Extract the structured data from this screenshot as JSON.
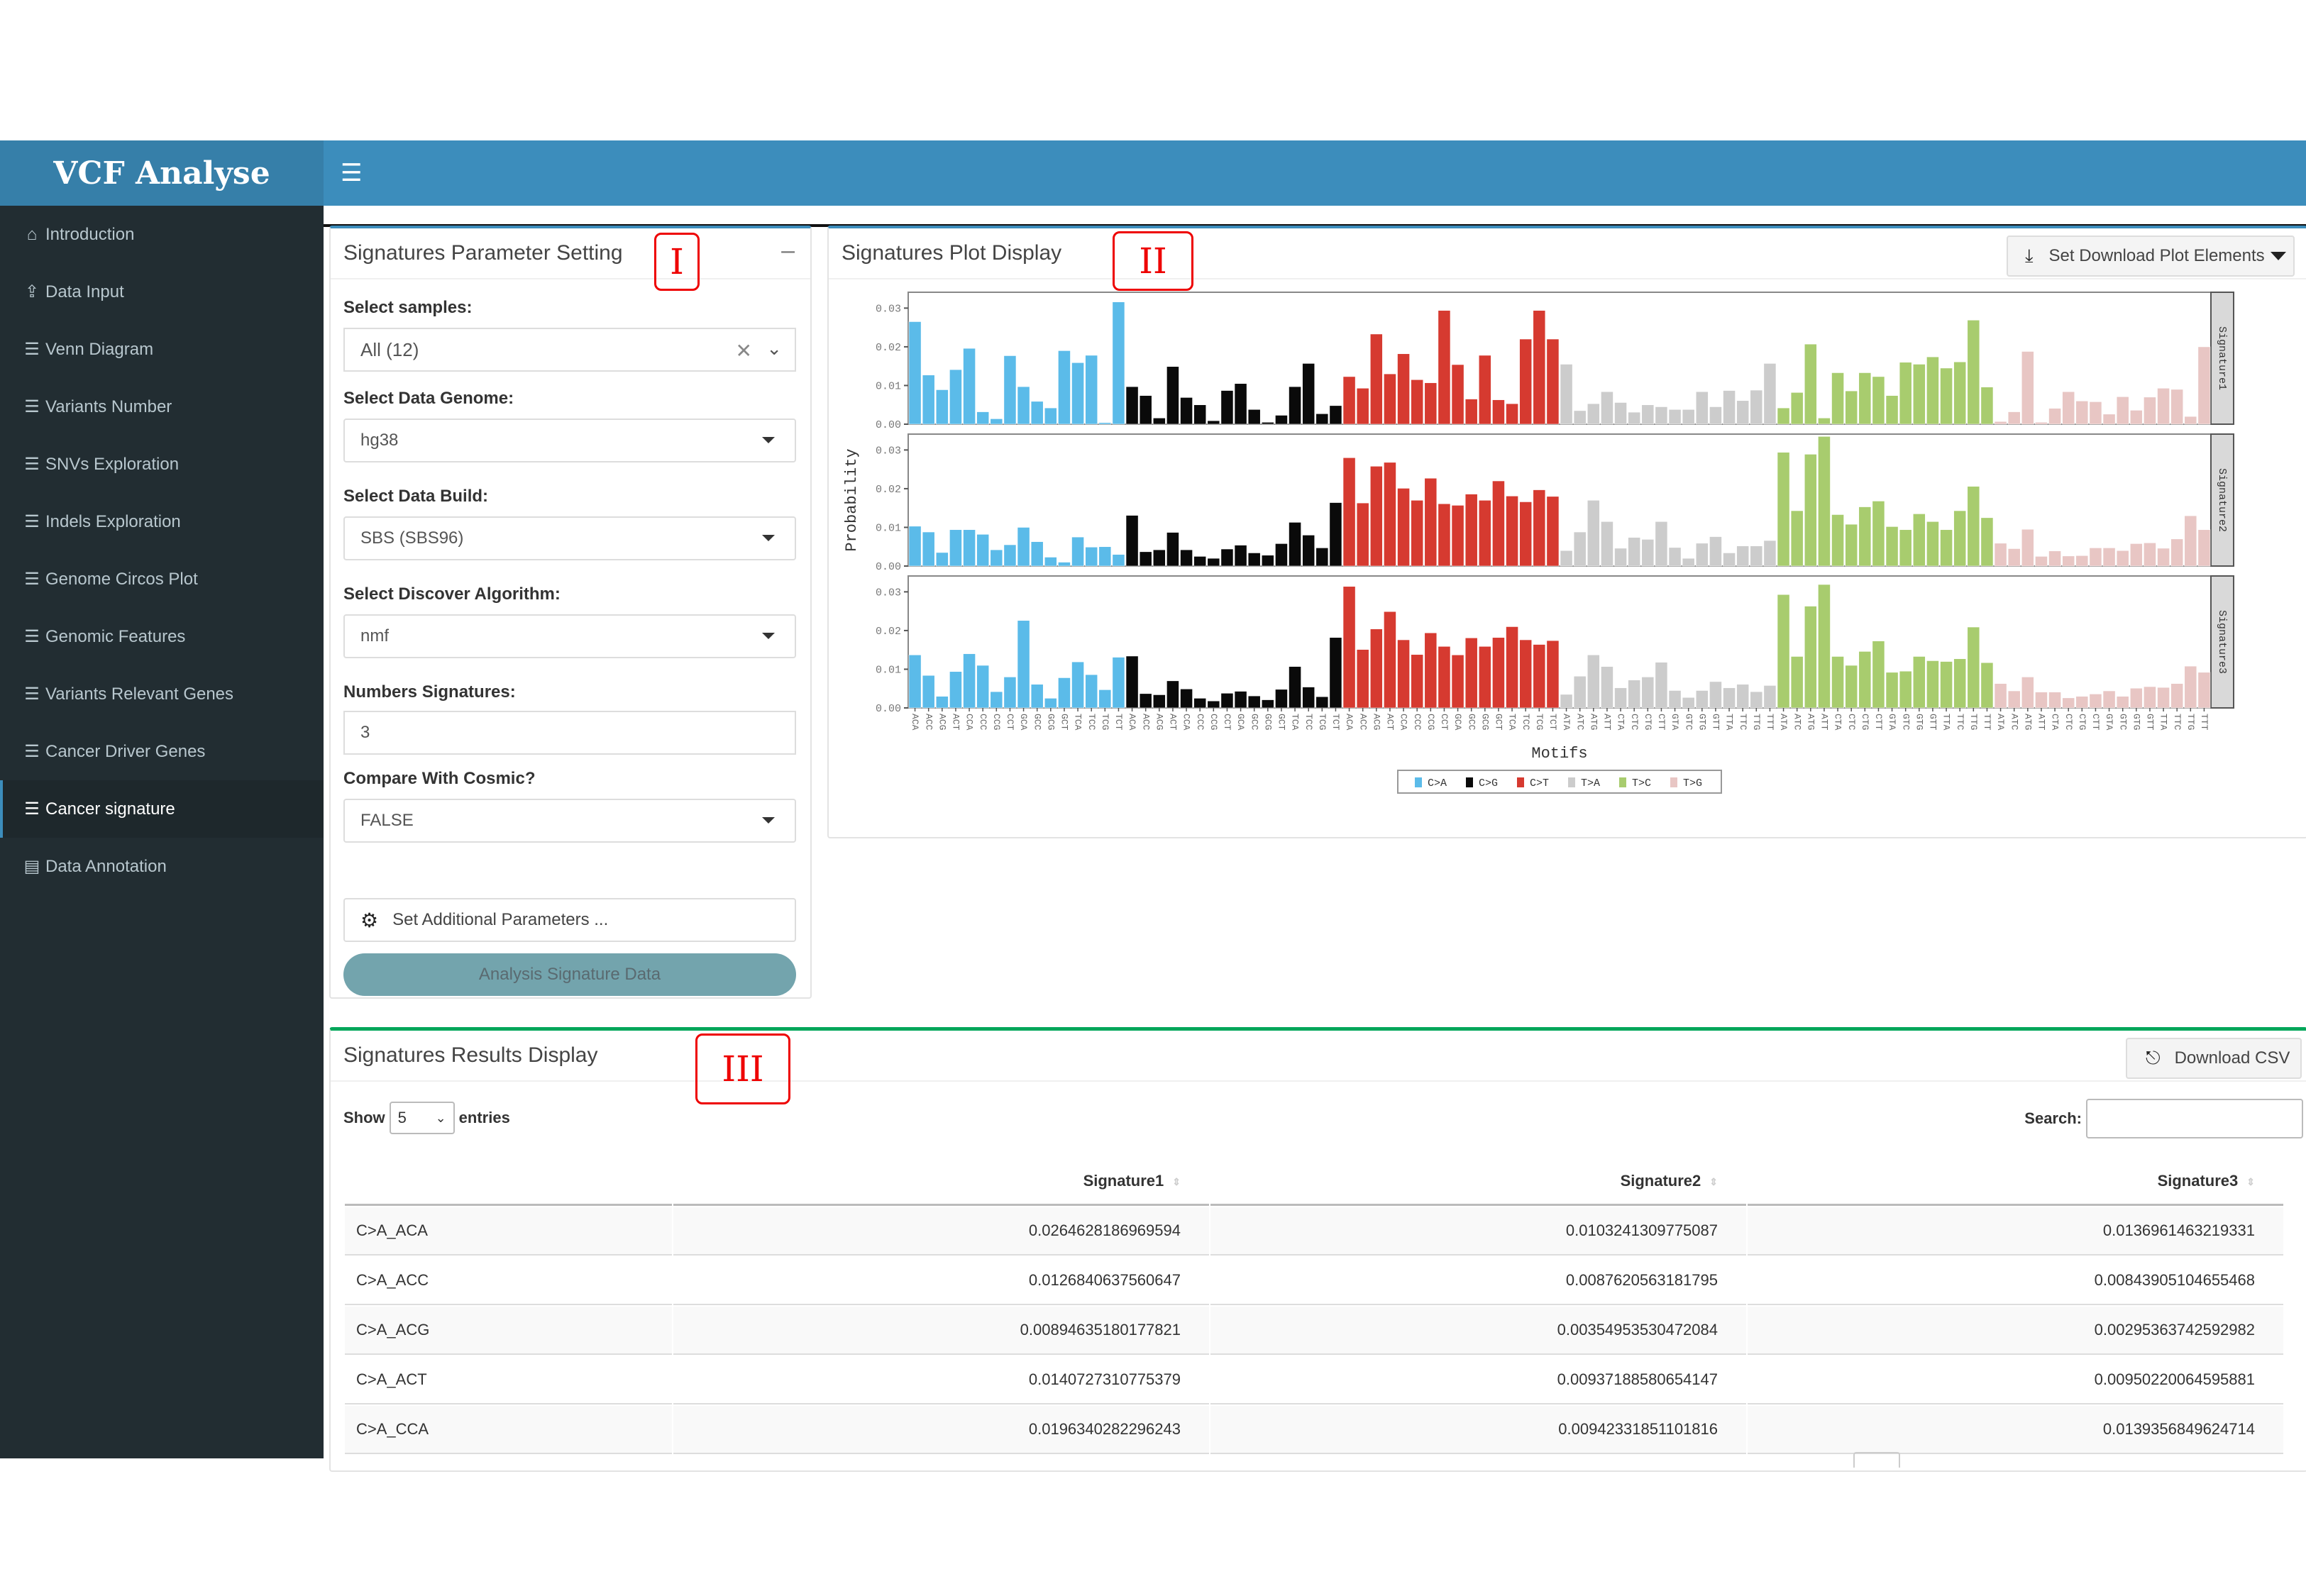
{
  "app": {
    "title": "VCF Analyse"
  },
  "sidebar": {
    "items": [
      {
        "label": "Introduction",
        "icon": "home-icon",
        "active": false
      },
      {
        "label": "Data Input",
        "icon": "upload-icon",
        "active": false
      },
      {
        "label": "Venn Diagram",
        "icon": "bar-chart-icon",
        "active": false
      },
      {
        "label": "Variants Number",
        "icon": "bar-chart-icon",
        "active": false
      },
      {
        "label": "SNVs Exploration",
        "icon": "bar-chart-icon",
        "active": false
      },
      {
        "label": "Indels Exploration",
        "icon": "bar-chart-icon",
        "active": false
      },
      {
        "label": "Genome Circos Plot",
        "icon": "bar-chart-icon",
        "active": false
      },
      {
        "label": "Genomic Features",
        "icon": "bar-chart-icon",
        "active": false
      },
      {
        "label": "Variants Relevant Genes",
        "icon": "bar-chart-icon",
        "active": false
      },
      {
        "label": "Cancer Driver Genes",
        "icon": "bar-chart-icon",
        "active": false
      },
      {
        "label": "Cancer signature",
        "icon": "bar-chart-icon",
        "active": true
      },
      {
        "label": "Data Annotation",
        "icon": "book-icon",
        "active": false
      }
    ]
  },
  "params": {
    "title": "Signatures Parameter Setting",
    "marker": "I",
    "samples_label": "Select samples:",
    "samples_value": "All (12)",
    "genome_label": "Select Data Genome:",
    "genome_value": "hg38",
    "build_label": "Select Data Build:",
    "build_value": "SBS (SBS96)",
    "algorithm_label": "Select Discover Algorithm:",
    "algorithm_value": "nmf",
    "numsig_label": "Numbers Signatures:",
    "numsig_value": "3",
    "cosmic_label": "Compare With Cosmic?",
    "cosmic_value": "FALSE",
    "additional_label": "Set Additional Parameters ...",
    "analysis_label": "Analysis Signature Data"
  },
  "plot": {
    "title": "Signatures Plot Display",
    "marker": "II",
    "download_label": "Set Download Plot Elements"
  },
  "results": {
    "title": "Signatures Results Display",
    "marker": "III",
    "download_label": "Download CSV",
    "show_label": "Show",
    "entries_label": "entries",
    "page_size": "5",
    "search_label": "Search:",
    "search_value": "",
    "columns": [
      "",
      "Signature1",
      "Signature2",
      "Signature3"
    ],
    "rows": [
      [
        "C>A_ACA",
        "0.0264628186969594",
        "0.0103241309775087",
        "0.0136961463219331"
      ],
      [
        "C>A_ACC",
        "0.0126840637560647",
        "0.0087620563181795",
        "0.00843905104655468"
      ],
      [
        "C>A_ACG",
        "0.00894635180177821",
        "0.00354953530472084",
        "0.00295363742592982"
      ],
      [
        "C>A_ACT",
        "0.0140727310775379",
        "0.00937188580654147",
        "0.00950220064595881"
      ],
      [
        "C>A_CCA",
        "0.0196340282296243",
        "0.00942331851101816",
        "0.0139356849624714"
      ]
    ]
  },
  "chart_data": {
    "type": "bar",
    "title": "",
    "xlabel": "Motifs",
    "ylabel": "Probability",
    "ylim": [
      0,
      0.033
    ],
    "yticks": [
      "0.00",
      "0.01",
      "0.02",
      "0.03"
    ],
    "grid": false,
    "legend_position": "bottom",
    "mutation_types": [
      "C>A",
      "C>G",
      "C>T",
      "T>A",
      "T>C",
      "T>G"
    ],
    "colors": {
      "C>A": "#5bbbe9",
      "C>G": "#0a0a0a",
      "C>T": "#d63a30",
      "T>A": "#cccccc",
      "T>C": "#a8cc6e",
      "T>G": "#e8c6c4"
    },
    "contexts": [
      "ACA",
      "ACC",
      "ACG",
      "ACT",
      "CCA",
      "CCC",
      "CCG",
      "CCT",
      "GCA",
      "GCC",
      "GCG",
      "GCT",
      "TCA",
      "TCC",
      "TCG",
      "TCT"
    ],
    "contexts_T": [
      "ATA",
      "ATC",
      "ATG",
      "ATT",
      "CTA",
      "CTC",
      "CTG",
      "CTT",
      "GTA",
      "GTC",
      "GTG",
      "GTT",
      "TTA",
      "TTC",
      "TTG",
      "TTT"
    ],
    "series": [
      {
        "name": "Signature1",
        "values": [
          0.0265,
          0.0127,
          0.0089,
          0.0141,
          0.0196,
          0.0032,
          0.0014,
          0.0177,
          0.0097,
          0.0059,
          0.0042,
          0.019,
          0.0159,
          0.0178,
          0.0004,
          0.0316,
          0.0097,
          0.0074,
          0.0016,
          0.0149,
          0.0069,
          0.005,
          0.0009,
          0.0087,
          0.0105,
          0.0038,
          0.0005,
          0.0023,
          0.0097,
          0.0157,
          0.0027,
          0.0048,
          0.0123,
          0.0093,
          0.0233,
          0.013,
          0.0182,
          0.0115,
          0.0107,
          0.0294,
          0.0154,
          0.0065,
          0.0178,
          0.0063,
          0.0053,
          0.022,
          0.0294,
          0.022,
          0.0155,
          0.0035,
          0.0053,
          0.0084,
          0.0056,
          0.0031,
          0.005,
          0.0045,
          0.0038,
          0.0038,
          0.0084,
          0.0045,
          0.0087,
          0.0061,
          0.0088,
          0.0157,
          0.0042,
          0.0082,
          0.0207,
          0.0016,
          0.0133,
          0.0086,
          0.0133,
          0.0123,
          0.0074,
          0.016,
          0.0155,
          0.0174,
          0.0145,
          0.0161,
          0.0269,
          0.0096,
          0.0007,
          0.0032,
          0.0188,
          0.0005,
          0.0041,
          0.0084,
          0.006,
          0.0058,
          0.0026,
          0.0071,
          0.0036,
          0.007,
          0.0093,
          0.009,
          0.002,
          0.02
        ]
      },
      {
        "name": "Signature2",
        "values": [
          0.0103,
          0.0088,
          0.0035,
          0.0094,
          0.0094,
          0.0082,
          0.0042,
          0.0055,
          0.01,
          0.0063,
          0.0023,
          0.001,
          0.0075,
          0.0049,
          0.005,
          0.003,
          0.0131,
          0.0037,
          0.0042,
          0.0087,
          0.0042,
          0.0025,
          0.002,
          0.0044,
          0.0054,
          0.0034,
          0.0028,
          0.0058,
          0.0113,
          0.008,
          0.0047,
          0.0164,
          0.028,
          0.0163,
          0.0258,
          0.0268,
          0.0201,
          0.017,
          0.0227,
          0.0161,
          0.0157,
          0.0186,
          0.017,
          0.022,
          0.0181,
          0.0166,
          0.0197,
          0.018,
          0.004,
          0.0088,
          0.017,
          0.0115,
          0.0046,
          0.0074,
          0.0069,
          0.0115,
          0.0048,
          0.002,
          0.0059,
          0.0076,
          0.0034,
          0.0052,
          0.0052,
          0.0066,
          0.0294,
          0.0143,
          0.0289,
          0.0335,
          0.0133,
          0.0108,
          0.0153,
          0.0168,
          0.0102,
          0.0094,
          0.0135,
          0.0115,
          0.0094,
          0.0143,
          0.0206,
          0.0125,
          0.0059,
          0.0045,
          0.0095,
          0.0025,
          0.0039,
          0.0026,
          0.0027,
          0.0047,
          0.0047,
          0.004,
          0.0058,
          0.006,
          0.0046,
          0.007,
          0.013,
          0.0094
        ]
      },
      {
        "name": "Signature3",
        "values": [
          0.0137,
          0.0084,
          0.003,
          0.0094,
          0.014,
          0.011,
          0.0042,
          0.008,
          0.0226,
          0.0061,
          0.0025,
          0.0078,
          0.0119,
          0.0086,
          0.0047,
          0.0131,
          0.0134,
          0.0037,
          0.0034,
          0.007,
          0.0049,
          0.0025,
          0.0018,
          0.0038,
          0.0043,
          0.0031,
          0.0021,
          0.0048,
          0.0107,
          0.0054,
          0.0029,
          0.0182,
          0.0314,
          0.0151,
          0.0204,
          0.0249,
          0.0176,
          0.0138,
          0.0194,
          0.0159,
          0.0137,
          0.0181,
          0.0159,
          0.0182,
          0.021,
          0.0176,
          0.0164,
          0.0174,
          0.0035,
          0.0082,
          0.0137,
          0.0107,
          0.0052,
          0.0072,
          0.008,
          0.0118,
          0.0045,
          0.0027,
          0.0045,
          0.0068,
          0.0052,
          0.0061,
          0.0042,
          0.0058,
          0.0293,
          0.0133,
          0.0263,
          0.0319,
          0.0133,
          0.011,
          0.0146,
          0.0173,
          0.0092,
          0.0095,
          0.0133,
          0.0122,
          0.012,
          0.0127,
          0.0209,
          0.0117,
          0.0063,
          0.0044,
          0.008,
          0.0041,
          0.0041,
          0.0026,
          0.003,
          0.0036,
          0.0044,
          0.003,
          0.0051,
          0.0055,
          0.0053,
          0.0063,
          0.0108,
          0.0092
        ]
      }
    ],
    "facet_labels": [
      "Signature1",
      "Signature2",
      "Signature3"
    ]
  }
}
